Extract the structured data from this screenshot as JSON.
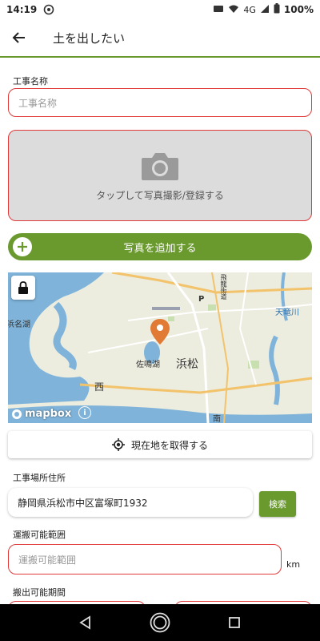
{
  "status_bar": {
    "time": "14:19",
    "network": "4G",
    "battery": "100%"
  },
  "app_bar": {
    "title": "土を出したい"
  },
  "construction_name": {
    "label": "工事名称",
    "placeholder": "工事名称"
  },
  "photo": {
    "prompt": "タップして写真撮影/登録する",
    "add_button": "写真を追加する"
  },
  "map": {
    "labels": {
      "lake": "浜名湖",
      "lake2": "佐鳴湖",
      "city": "浜松",
      "west": "西",
      "south": "南",
      "river": "天竜川",
      "road": "飛龍街道",
      "parking": "P"
    },
    "attribution": "mapbox",
    "info": "i"
  },
  "location_button": "現在地を取得する",
  "address": {
    "label": "工事場所住所",
    "value": "静岡県浜松市中区富塚町1932",
    "search_button": "検索"
  },
  "transport_range": {
    "label": "運搬可能範囲",
    "placeholder": "運搬可能範囲",
    "unit": "km"
  },
  "transport_period": {
    "label": "搬出可能期間"
  },
  "colors": {
    "accent": "#6a9a2e",
    "error": "#e03a3a",
    "pin": "#e07a35"
  }
}
